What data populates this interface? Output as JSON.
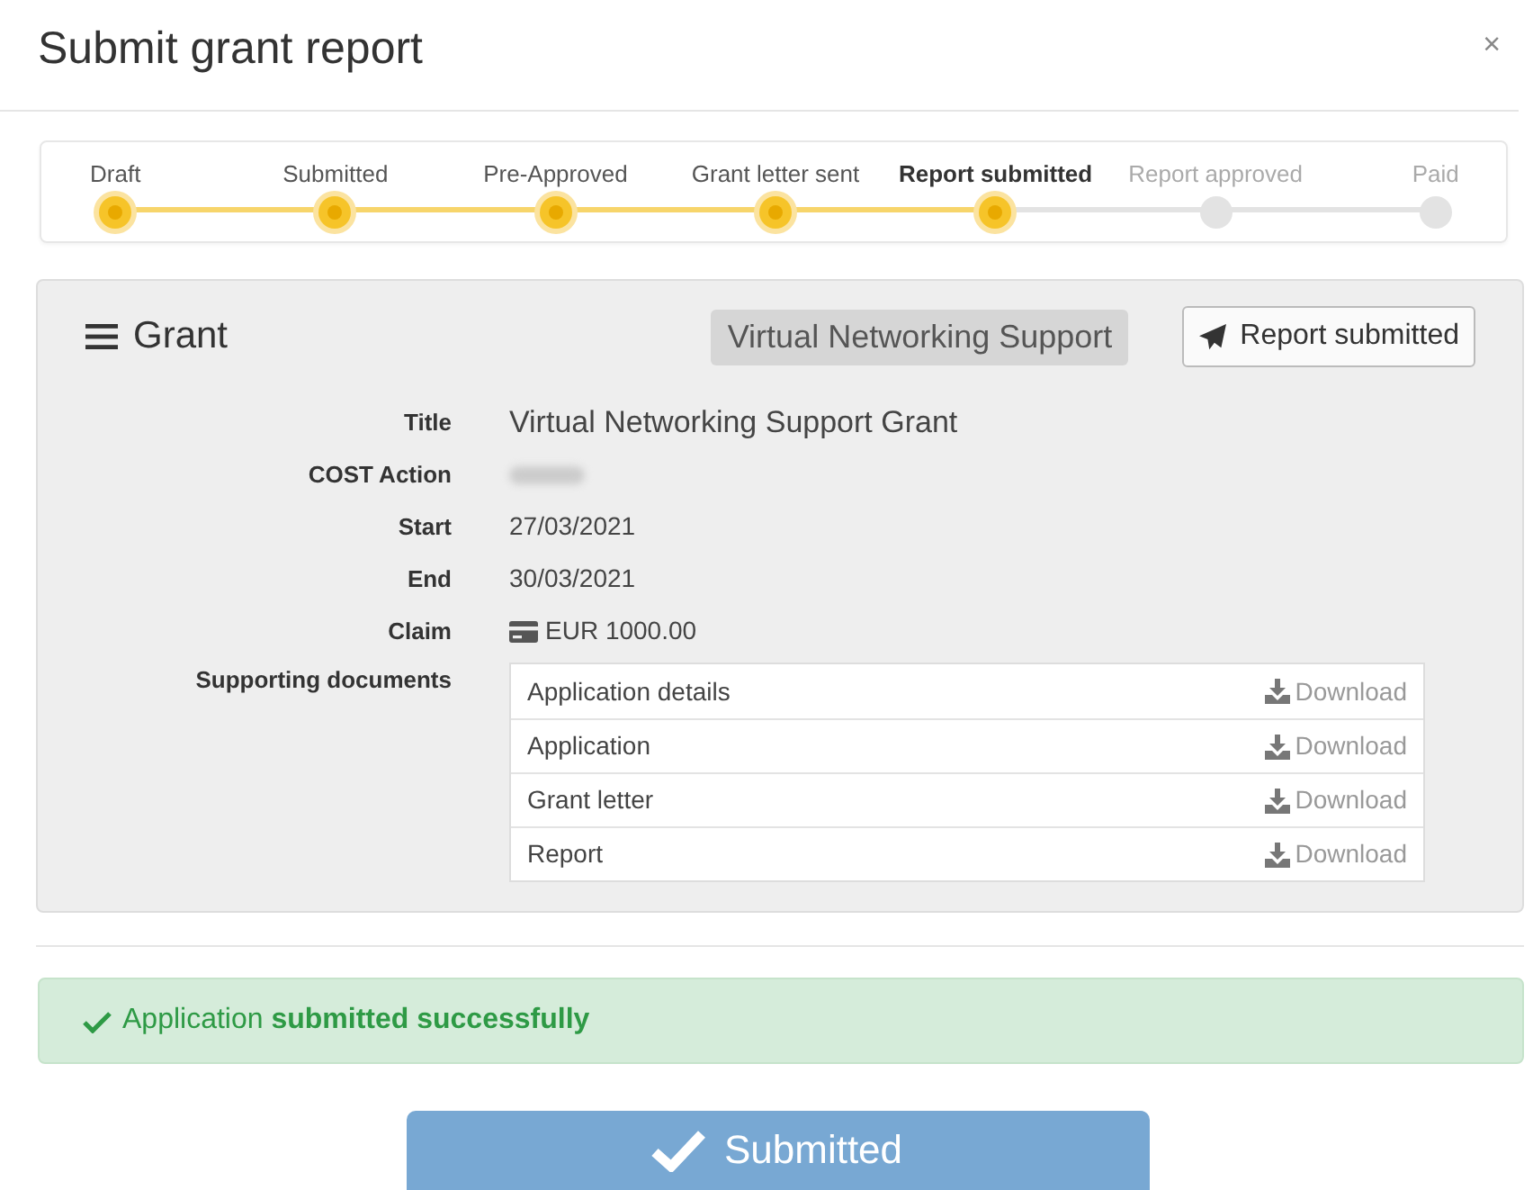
{
  "modal": {
    "title": "Submit grant report",
    "close": "×"
  },
  "steps": [
    {
      "label": "Draft",
      "reached": true,
      "current": false
    },
    {
      "label": "Submitted",
      "reached": true,
      "current": false
    },
    {
      "label": "Pre-Approved",
      "reached": true,
      "current": false
    },
    {
      "label": "Grant letter sent",
      "reached": true,
      "current": false
    },
    {
      "label": "Report submitted",
      "reached": true,
      "current": true
    },
    {
      "label": "Report approved",
      "reached": false,
      "current": false
    },
    {
      "label": "Paid",
      "reached": false,
      "current": false
    }
  ],
  "grant": {
    "heading": "Grant",
    "type_badge": "Virtual Networking Support",
    "status_button": "Report submitted",
    "details": [
      {
        "label": "Title",
        "kind": "large",
        "value": "Virtual Networking Support Grant"
      },
      {
        "label": "COST Action",
        "kind": "redacted"
      },
      {
        "label": "Start",
        "kind": "text",
        "value": "27/03/2021"
      },
      {
        "label": "End",
        "kind": "text",
        "value": "30/03/2021"
      },
      {
        "label": "Claim",
        "kind": "money",
        "value": "EUR 1000.00"
      }
    ],
    "documents_label": "Supporting documents",
    "documents": [
      {
        "name": "Application details",
        "action": "Download"
      },
      {
        "name": "Application",
        "action": "Download"
      },
      {
        "name": "Grant letter",
        "action": "Download"
      },
      {
        "name": "Report",
        "action": "Download"
      }
    ]
  },
  "alert": {
    "text": "Application **submitted successfully**"
  },
  "submit_button": {
    "label": "Submitted",
    "disabled": true
  }
}
